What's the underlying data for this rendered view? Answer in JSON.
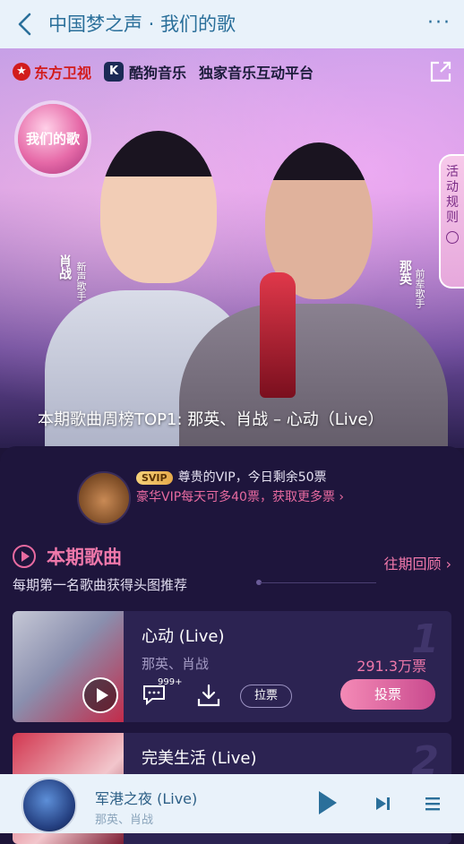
{
  "header": {
    "title": "中国梦之声 · 我们的歌"
  },
  "banner": {
    "logo_dongfang": "东方卫视",
    "logo_kugou": "酷狗音乐",
    "platform_text": "独家音乐互动平台",
    "show_badge": "我们的歌",
    "rules_tab": "活动规则",
    "singer1_name": "肖战",
    "singer1_role": "新声歌手",
    "singer2_name": "那英",
    "singer2_role": "前辈歌手",
    "caption": "本期歌曲周榜TOP1: 那英、肖战 – 心动（Live）"
  },
  "vip": {
    "badge": "SVIP",
    "line1": "尊贵的VIP，今日剩余50票",
    "line2": "豪华VIP每天可多40票，获取更多票 ›"
  },
  "section": {
    "title": "本期歌曲",
    "subtitle": "每期第一名歌曲获得头图推荐",
    "past_link": "往期回顾 ›"
  },
  "songs": [
    {
      "rank": "1",
      "name": "心动 (Live)",
      "artist": "那英、肖战",
      "votes": "291.3万票",
      "comment_count": "999+",
      "pull_label": "拉票",
      "vote_label": "投票"
    },
    {
      "rank": "2",
      "name": "完美生活 (Live)"
    }
  ],
  "player": {
    "title": "军港之夜 (Live)",
    "artist": "那英、肖战"
  },
  "colors": {
    "accent": "#ef78aa",
    "header_bg": "#e9f2fa",
    "header_text": "#2a6f9a",
    "panel_bg": "#1e153c"
  }
}
